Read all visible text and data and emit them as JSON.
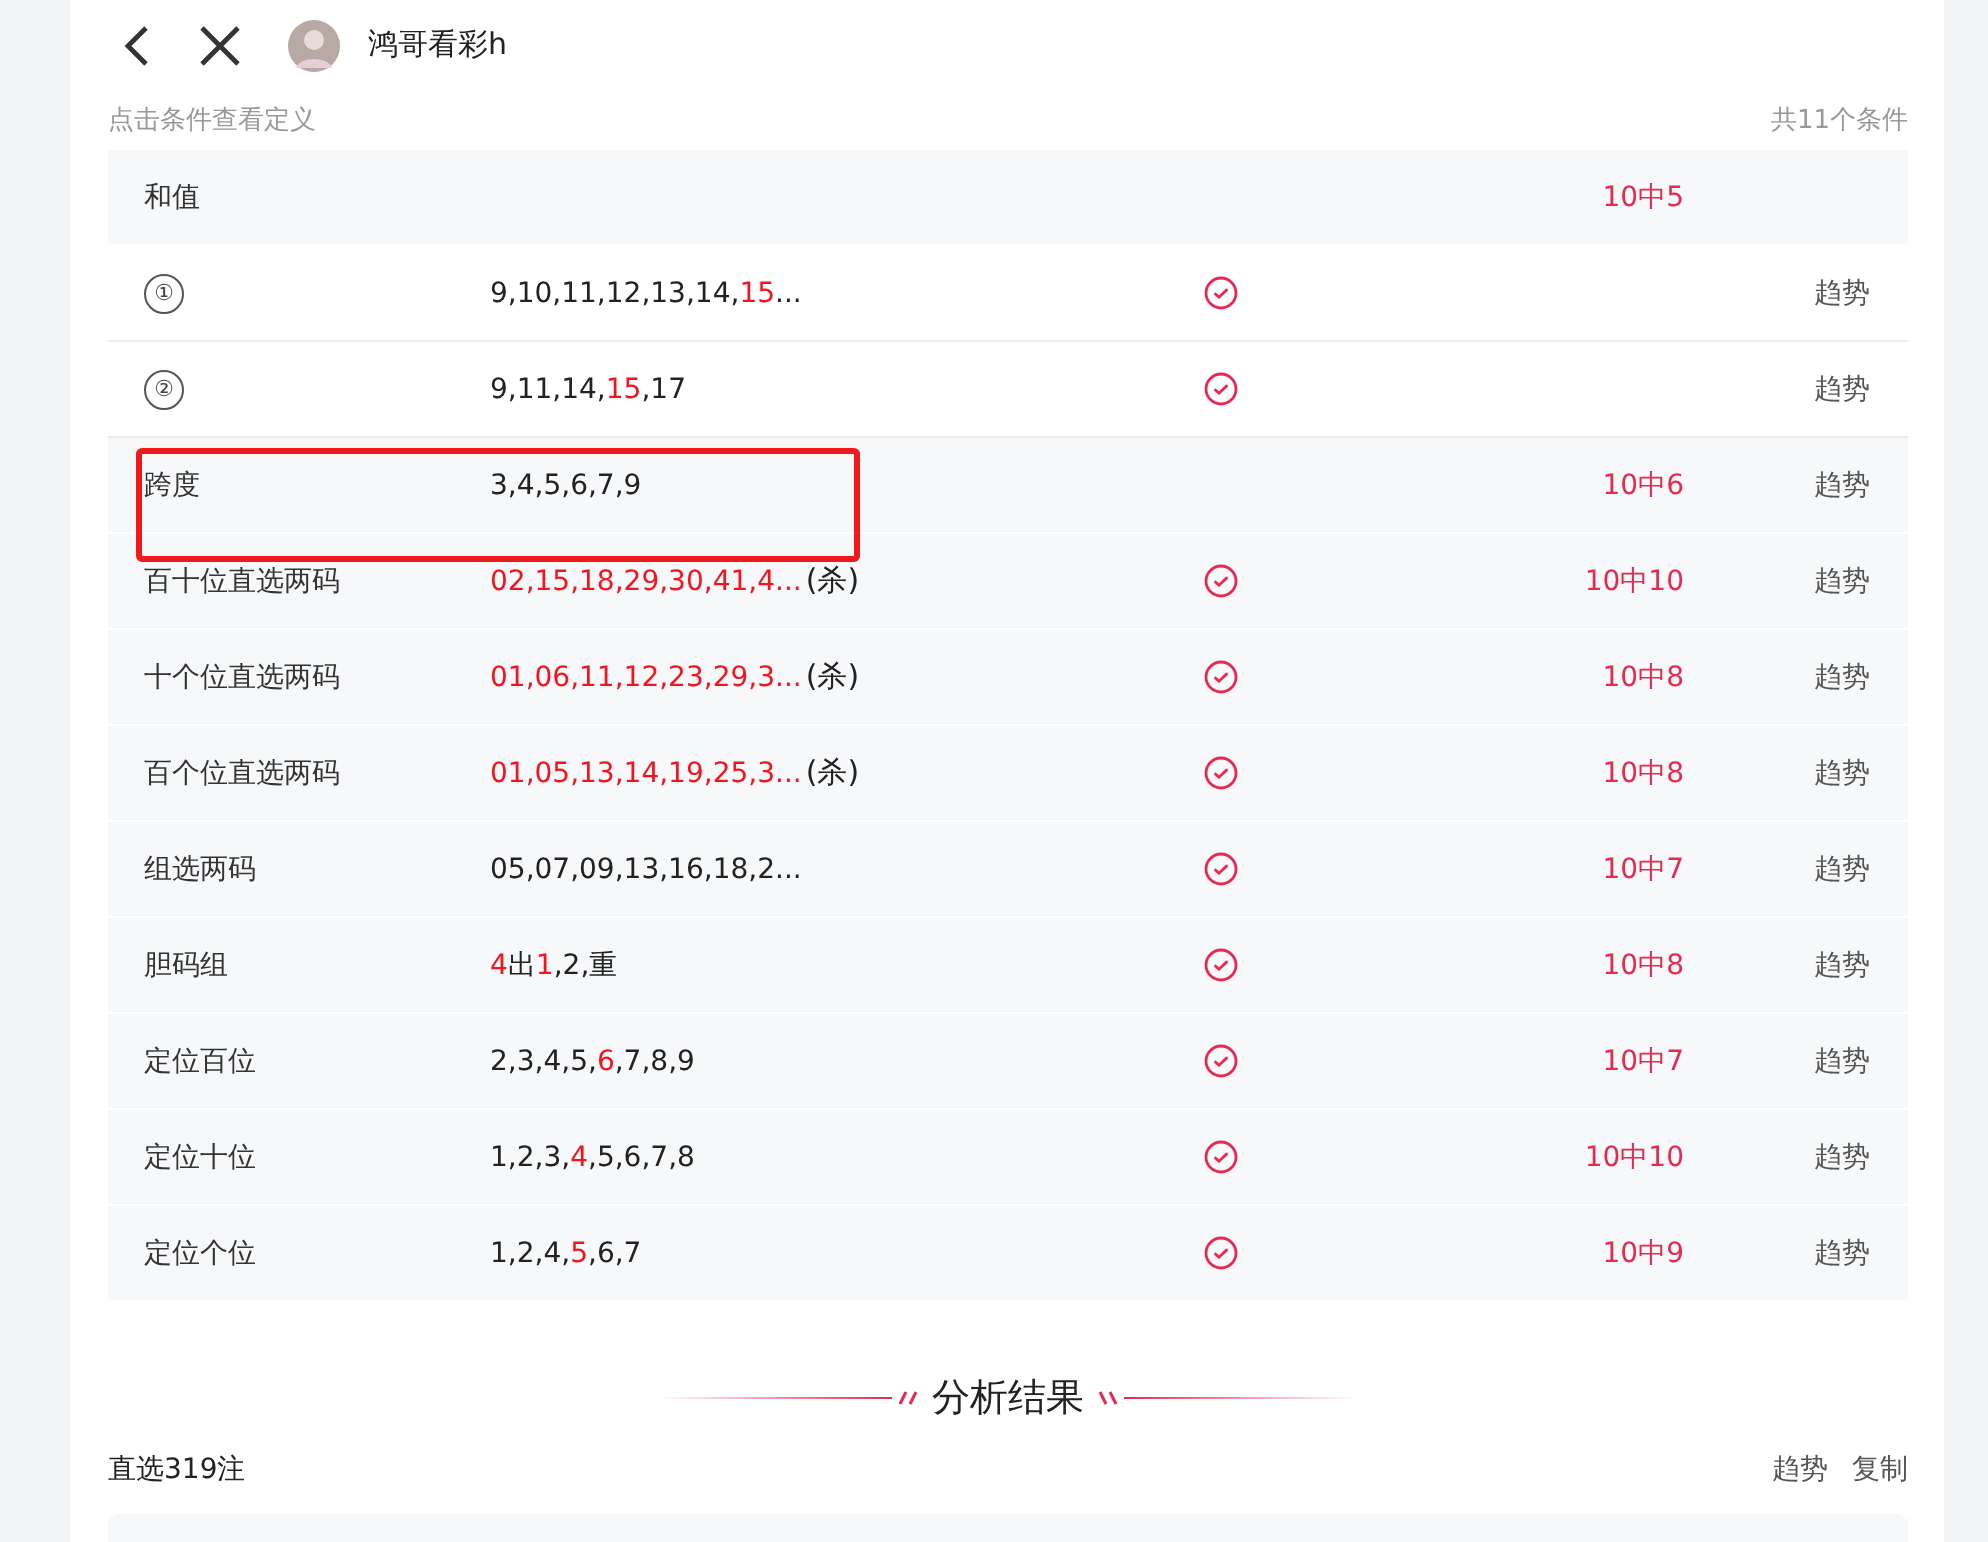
{
  "header": {
    "username": "鸿哥看彩h"
  },
  "hint": "点击条件查看定义",
  "count": "共11个条件",
  "rows": [
    {
      "kind": "main",
      "name": "和值",
      "checked": false,
      "highlight": false,
      "segments": [],
      "result": "10中5"
    },
    {
      "kind": "sub",
      "name": "①",
      "checked": true,
      "highlight": false,
      "segments": [
        {
          "text": "9,10,11,12,13,14,",
          "hit": false
        },
        {
          "text": "15",
          "hit": true
        },
        {
          "text": "...",
          "hit": false
        }
      ],
      "trend": "趋势"
    },
    {
      "kind": "sub",
      "name": "②",
      "checked": true,
      "highlight": false,
      "segments": [
        {
          "text": "9,11,14,",
          "hit": false
        },
        {
          "text": "15",
          "hit": true
        },
        {
          "text": ",17",
          "hit": false
        }
      ],
      "trend": "趋势"
    },
    {
      "kind": "main",
      "name": "跨度",
      "checked": false,
      "highlight": true,
      "segments": [
        {
          "text": "3,4,5,6,7,9",
          "hit": false
        }
      ],
      "result": "10中6",
      "trend": "趋势"
    },
    {
      "kind": "main",
      "name": "百十位直选两码",
      "checked": true,
      "highlight": false,
      "segments": [
        {
          "text": "02,15,18,29,30,41,4...",
          "hit": true
        }
      ],
      "suffix": "(杀)",
      "result": "10中10",
      "trend": "趋势"
    },
    {
      "kind": "main",
      "name": "十个位直选两码",
      "checked": true,
      "highlight": false,
      "segments": [
        {
          "text": "01,06,11,12,23,29,3...",
          "hit": true
        }
      ],
      "suffix": "(杀)",
      "result": "10中8",
      "trend": "趋势"
    },
    {
      "kind": "main",
      "name": "百个位直选两码",
      "checked": true,
      "highlight": false,
      "segments": [
        {
          "text": "01,05,13,14,19,25,3...",
          "hit": true
        }
      ],
      "suffix": "(杀)",
      "result": "10中8",
      "trend": "趋势"
    },
    {
      "kind": "main",
      "name": "组选两码",
      "checked": true,
      "highlight": false,
      "segments": [
        {
          "text": "05,07,09,13,16,18,2...",
          "hit": false
        }
      ],
      "result": "10中7",
      "trend": "趋势"
    },
    {
      "kind": "main",
      "name": "胆码组",
      "checked": true,
      "highlight": false,
      "segments": [
        {
          "text": "4",
          "hit": true
        },
        {
          "text": "出",
          "hit": false
        },
        {
          "text": "1",
          "hit": true
        },
        {
          "text": ",2,重",
          "hit": false
        }
      ],
      "result": "10中8",
      "trend": "趋势"
    },
    {
      "kind": "main",
      "name": "定位百位",
      "checked": true,
      "highlight": false,
      "segments": [
        {
          "text": "2,3,4,5,",
          "hit": false
        },
        {
          "text": "6",
          "hit": true
        },
        {
          "text": ",7,8,9",
          "hit": false
        }
      ],
      "result": "10中7",
      "trend": "趋势"
    },
    {
      "kind": "main",
      "name": "定位十位",
      "checked": true,
      "highlight": false,
      "segments": [
        {
          "text": "1,2,3,",
          "hit": false
        },
        {
          "text": "4",
          "hit": true
        },
        {
          "text": ",5,6,7,8",
          "hit": false
        }
      ],
      "result": "10中10",
      "trend": "趋势"
    },
    {
      "kind": "main",
      "name": "定位个位",
      "checked": true,
      "highlight": false,
      "segments": [
        {
          "text": "1,2,4,",
          "hit": false
        },
        {
          "text": "5",
          "hit": true
        },
        {
          "text": ",6,7",
          "hit": false
        }
      ],
      "result": "10中9",
      "trend": "趋势"
    }
  ],
  "analysis": {
    "title": "分析结果",
    "summary": "直选319注",
    "actions": [
      "趋势",
      "复制"
    ]
  }
}
